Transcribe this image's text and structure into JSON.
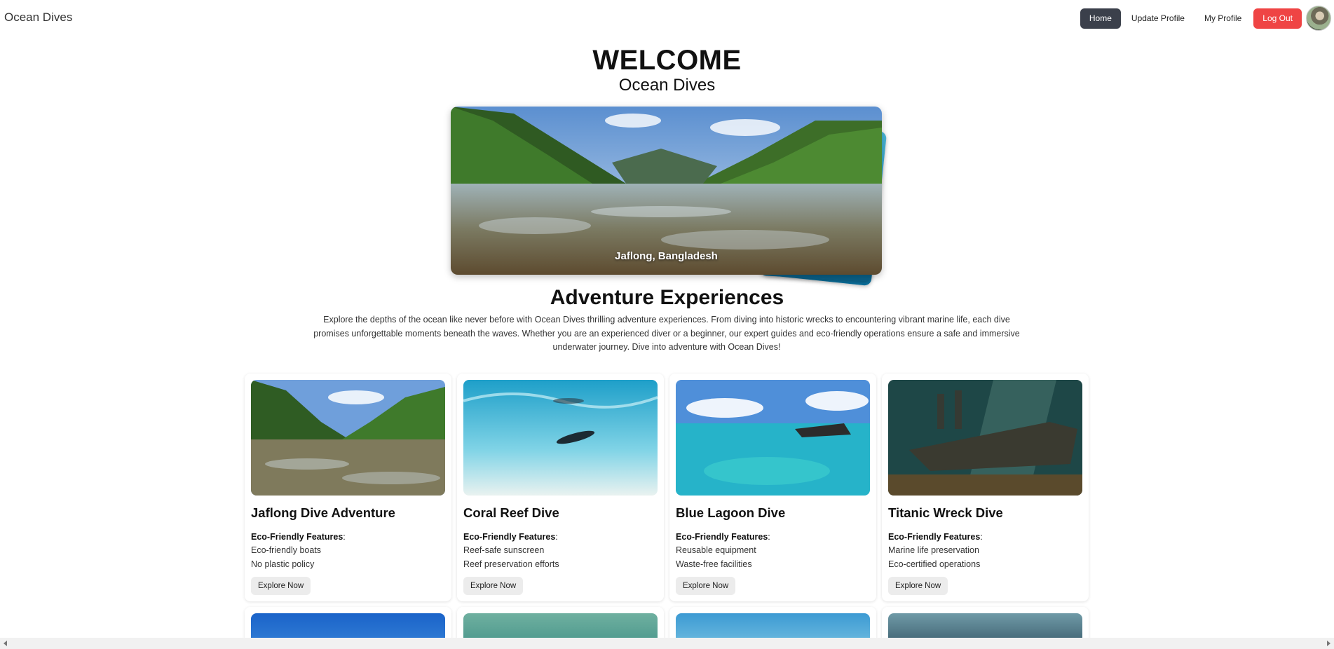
{
  "navbar": {
    "brand": "Ocean Dives",
    "links": [
      "Home",
      "Update Profile",
      "My Profile",
      "Log Out"
    ]
  },
  "hero": {
    "welcome": "WELCOME",
    "subtitle": "Ocean Dives",
    "slide_caption": "Jaflong, Bangladesh"
  },
  "adventure": {
    "title": "Adventure Experiences",
    "description": "Explore the depths of the ocean like never before with Ocean Dives thrilling adventure experiences. From diving into historic wrecks to encountering vibrant marine life, each dive promises unforgettable moments beneath the waves. Whether you are an experienced diver or a beginner, our expert guides and eco-friendly operations ensure a safe and immersive underwater journey. Dive into adventure with Ocean Dives!"
  },
  "cards": [
    {
      "title": "Jaflong Dive Adventure",
      "features_label": "Eco-Friendly Features",
      "features": [
        "Eco-friendly boats",
        "No plastic policy"
      ],
      "button": "Explore Now"
    },
    {
      "title": "Coral Reef Dive",
      "features_label": "Eco-Friendly Features",
      "features": [
        "Reef-safe sunscreen",
        "Reef preservation efforts"
      ],
      "button": "Explore Now"
    },
    {
      "title": "Blue Lagoon Dive",
      "features_label": "Eco-Friendly Features",
      "features": [
        "Reusable equipment",
        "Waste-free facilities"
      ],
      "button": "Explore Now"
    },
    {
      "title": "Titanic Wreck Dive",
      "features_label": "Eco-Friendly Features",
      "features": [
        "Marine life preservation",
        "Eco-certified operations"
      ],
      "button": "Explore Now"
    }
  ],
  "colors": {
    "home_active": "#3b404b",
    "logout": "#ef4444",
    "button_bg": "#ececec"
  }
}
